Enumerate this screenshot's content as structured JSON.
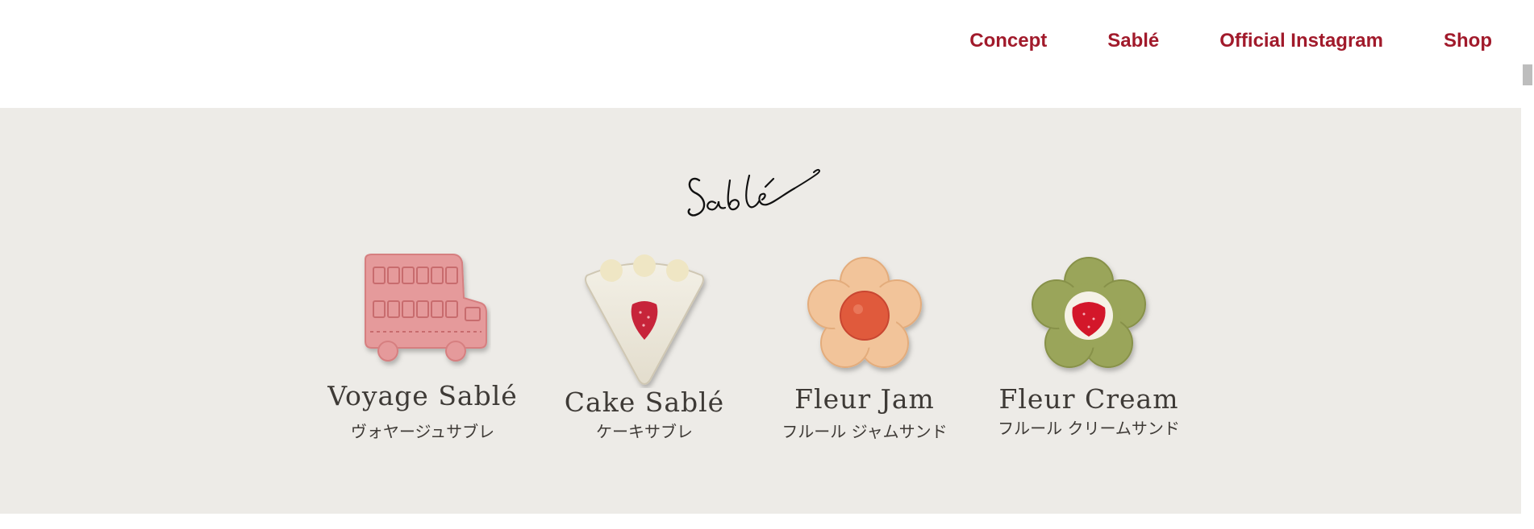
{
  "header": {
    "nav": [
      {
        "label": "Concept"
      },
      {
        "label": "Sablé"
      },
      {
        "label": "Official Instagram"
      },
      {
        "label": "Shop"
      }
    ],
    "nav_color": "#a11a2b"
  },
  "section": {
    "title": "Sablé",
    "background": "#edebe7",
    "products": [
      {
        "name": "Voyage Sablé",
        "japanese": "ヴォヤージュサブレ",
        "icon": "bus-sable-icon"
      },
      {
        "name": "Cake Sablé",
        "japanese": "ケーキサブレ",
        "icon": "cake-sable-icon"
      },
      {
        "name": "Fleur Jam",
        "japanese": "フルール ジャムサンド",
        "icon": "fleur-jam-icon"
      },
      {
        "name": "Fleur Cream",
        "japanese": "フルール クリームサンド",
        "icon": "fleur-cream-icon"
      }
    ]
  }
}
